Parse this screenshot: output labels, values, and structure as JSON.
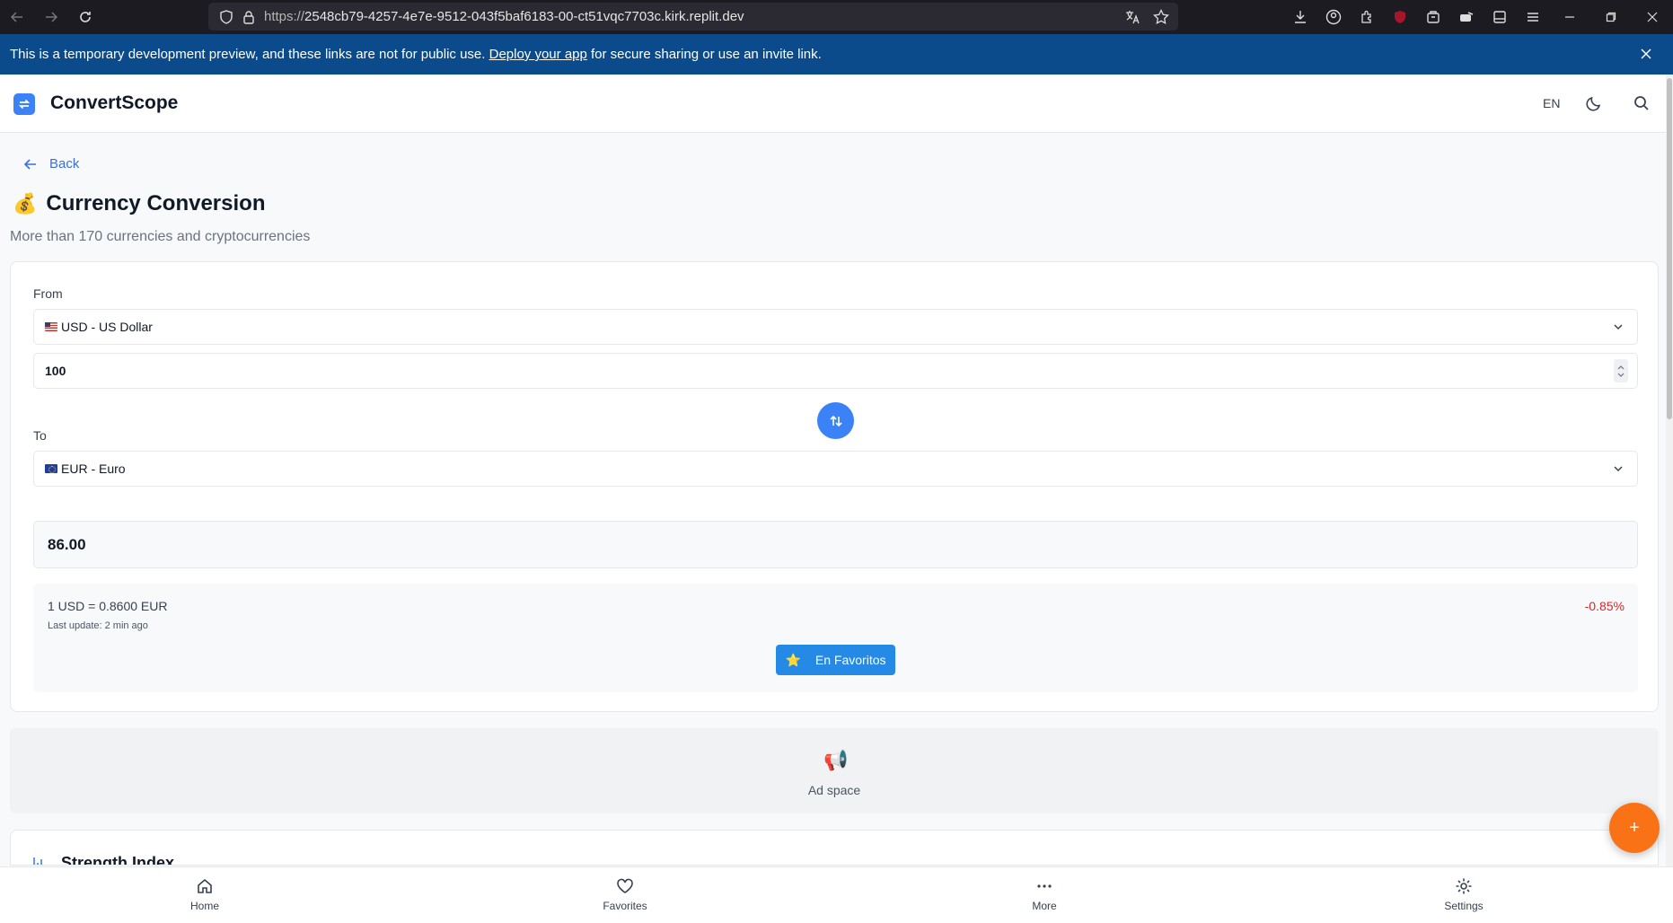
{
  "browser": {
    "url_prefix": "https://",
    "url_host": "2548cb79-4257-4e7e-9512-043f5baf6183-00-ct51vqc7703c.kirk.replit.dev"
  },
  "banner": {
    "text_before": "This is a temporary development preview, and these links are not for public use. ",
    "link": "Deploy your app",
    "text_after": " for secure sharing or use an invite link."
  },
  "header": {
    "app_name": "ConvertScope",
    "language": "EN"
  },
  "page": {
    "back_label": "Back",
    "title_emoji": "💰",
    "title": "Currency Conversion",
    "subtitle": "More than 170 currencies and cryptocurrencies"
  },
  "converter": {
    "from_label": "From",
    "from_currency": "USD - US Dollar",
    "amount": "100",
    "to_label": "To",
    "to_currency": "EUR - Euro",
    "result": "86.00",
    "rate_text": "1 USD = 0.8600 EUR",
    "last_update": "Last update: 2 min ago",
    "change": "-0.85%",
    "favorite_label": "En Favoritos",
    "favorite_emoji": "⭐"
  },
  "ad": {
    "label": "Ad space",
    "emoji": "📢"
  },
  "strength": {
    "title": "Strength Index"
  },
  "fab": {
    "symbol": "+"
  },
  "bottom_nav": {
    "home": "Home",
    "favorites": "Favorites",
    "more": "More",
    "settings": "Settings"
  },
  "colors": {
    "primary": "#3b82f6",
    "banner": "#0b4a8b",
    "negative": "#dc2626",
    "fab": "#f97316"
  }
}
